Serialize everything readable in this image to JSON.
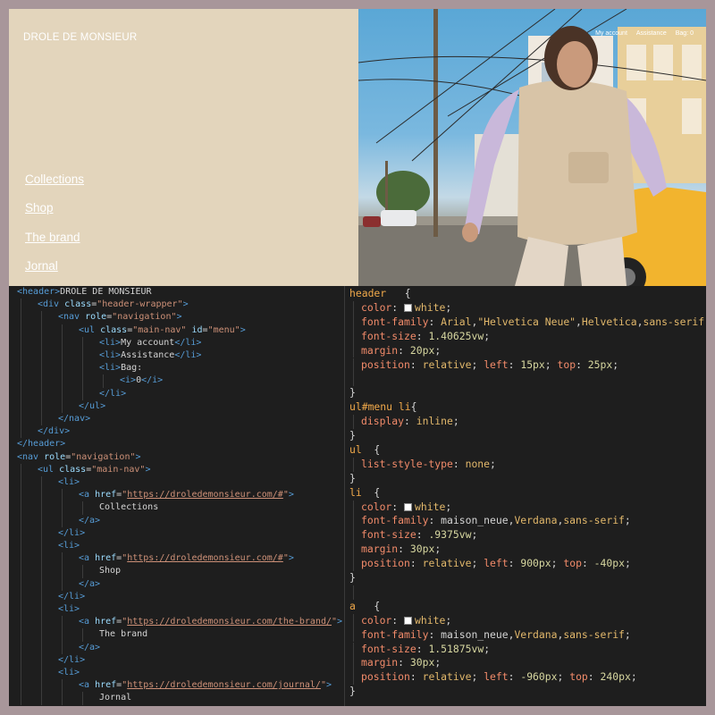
{
  "preview": {
    "brand": "DROLE DE MONSIEUR",
    "side_nav": [
      "Collections",
      "Shop",
      "The brand",
      "Jornal"
    ],
    "top_nav": [
      "My account",
      "Assistance",
      "Bag: 0"
    ]
  },
  "html_code": [
    {
      "indent": 0,
      "parts": [
        [
          "tag",
          "<header>"
        ],
        [
          "txt",
          "DROLE DE MONSIEUR"
        ]
      ]
    },
    {
      "indent": 1,
      "parts": [
        [
          "tag",
          "<div "
        ],
        [
          "attr",
          "class"
        ],
        [
          "txt",
          "="
        ],
        [
          "val",
          "\"header-wrapper\""
        ],
        [
          "tag",
          ">"
        ]
      ]
    },
    {
      "indent": 2,
      "parts": [
        [
          "tag",
          "<nav "
        ],
        [
          "attr",
          "role"
        ],
        [
          "txt",
          "="
        ],
        [
          "val",
          "\"navigation\""
        ],
        [
          "tag",
          ">"
        ]
      ]
    },
    {
      "indent": 3,
      "parts": [
        [
          "tag",
          "<ul "
        ],
        [
          "attr",
          "class"
        ],
        [
          "txt",
          "="
        ],
        [
          "val",
          "\"main-nav\""
        ],
        [
          "txt",
          " "
        ],
        [
          "attr",
          "id"
        ],
        [
          "txt",
          "="
        ],
        [
          "val",
          "\"menu\""
        ],
        [
          "tag",
          ">"
        ]
      ]
    },
    {
      "indent": 4,
      "parts": [
        [
          "tag",
          "<li>"
        ],
        [
          "txt",
          "My account"
        ],
        [
          "tag",
          "</li>"
        ]
      ]
    },
    {
      "indent": 4,
      "parts": [
        [
          "tag",
          "<li>"
        ],
        [
          "txt",
          "Assistance"
        ],
        [
          "tag",
          "</li>"
        ]
      ]
    },
    {
      "indent": 4,
      "parts": [
        [
          "tag",
          "<li>"
        ],
        [
          "txt",
          "Bag:"
        ]
      ]
    },
    {
      "indent": 5,
      "parts": [
        [
          "tag",
          "<i>"
        ],
        [
          "txt",
          "0"
        ],
        [
          "tag",
          "</i>"
        ]
      ]
    },
    {
      "indent": 4,
      "parts": [
        [
          "tag",
          "</li>"
        ]
      ]
    },
    {
      "indent": 3,
      "parts": [
        [
          "tag",
          "</ul>"
        ]
      ]
    },
    {
      "indent": 2,
      "parts": [
        [
          "tag",
          "</nav>"
        ]
      ]
    },
    {
      "indent": 1,
      "parts": [
        [
          "tag",
          "</div>"
        ]
      ]
    },
    {
      "indent": 0,
      "parts": [
        [
          "tag",
          "</header>"
        ]
      ]
    },
    {
      "indent": 0,
      "parts": [
        [
          "tag",
          "<nav "
        ],
        [
          "attr",
          "role"
        ],
        [
          "txt",
          "="
        ],
        [
          "val",
          "\"navigation\""
        ],
        [
          "tag",
          ">"
        ]
      ]
    },
    {
      "indent": 1,
      "parts": [
        [
          "tag",
          "<ul "
        ],
        [
          "attr",
          "class"
        ],
        [
          "txt",
          "="
        ],
        [
          "val",
          "\"main-nav\""
        ],
        [
          "tag",
          ">"
        ]
      ]
    },
    {
      "indent": 2,
      "parts": [
        [
          "tag",
          "<li>"
        ]
      ]
    },
    {
      "indent": 3,
      "parts": [
        [
          "tag",
          "<a "
        ],
        [
          "attr",
          "href"
        ],
        [
          "txt",
          "="
        ],
        [
          "val",
          "\""
        ],
        [
          "url",
          "https://droledemonsieur.com/#"
        ],
        [
          "val",
          "\""
        ],
        [
          "tag",
          ">"
        ]
      ]
    },
    {
      "indent": 4,
      "parts": [
        [
          "txt",
          "Collections"
        ]
      ]
    },
    {
      "indent": 3,
      "parts": [
        [
          "tag",
          "</a>"
        ]
      ]
    },
    {
      "indent": 2,
      "parts": [
        [
          "tag",
          "</li>"
        ]
      ]
    },
    {
      "indent": 2,
      "parts": [
        [
          "tag",
          "<li>"
        ]
      ]
    },
    {
      "indent": 3,
      "parts": [
        [
          "tag",
          "<a "
        ],
        [
          "attr",
          "href"
        ],
        [
          "txt",
          "="
        ],
        [
          "val",
          "\""
        ],
        [
          "url",
          "https://droledemonsieur.com/#"
        ],
        [
          "val",
          "\""
        ],
        [
          "tag",
          ">"
        ]
      ]
    },
    {
      "indent": 4,
      "parts": [
        [
          "txt",
          "Shop"
        ]
      ]
    },
    {
      "indent": 3,
      "parts": [
        [
          "tag",
          "</a>"
        ]
      ]
    },
    {
      "indent": 2,
      "parts": [
        [
          "tag",
          "</li>"
        ]
      ]
    },
    {
      "indent": 2,
      "parts": [
        [
          "tag",
          "<li>"
        ]
      ]
    },
    {
      "indent": 3,
      "parts": [
        [
          "tag",
          "<a "
        ],
        [
          "attr",
          "href"
        ],
        [
          "txt",
          "="
        ],
        [
          "val",
          "\""
        ],
        [
          "url",
          "https://droledemonsieur.com/the-brand/"
        ],
        [
          "val",
          "\""
        ],
        [
          "tag",
          ">"
        ]
      ]
    },
    {
      "indent": 4,
      "parts": [
        [
          "txt",
          "The brand"
        ]
      ]
    },
    {
      "indent": 3,
      "parts": [
        [
          "tag",
          "</a>"
        ]
      ]
    },
    {
      "indent": 2,
      "parts": [
        [
          "tag",
          "</li>"
        ]
      ]
    },
    {
      "indent": 2,
      "parts": [
        [
          "tag",
          "<li>"
        ]
      ]
    },
    {
      "indent": 3,
      "parts": [
        [
          "tag",
          "<a "
        ],
        [
          "attr",
          "href"
        ],
        [
          "txt",
          "="
        ],
        [
          "val",
          "\""
        ],
        [
          "url",
          "https://droledemonsieur.com/journal/"
        ],
        [
          "val",
          "\""
        ],
        [
          "tag",
          ">"
        ]
      ]
    },
    {
      "indent": 4,
      "parts": [
        [
          "txt",
          "Jornal"
        ]
      ]
    }
  ],
  "css_code": [
    {
      "indent": 0,
      "parts": [
        [
          "sel",
          "header"
        ],
        [
          "pun",
          "   {"
        ]
      ]
    },
    {
      "indent": 1,
      "parts": [
        [
          "prop",
          "color"
        ],
        [
          "pun",
          ": "
        ],
        [
          "swatch",
          ""
        ],
        [
          "val",
          "white"
        ],
        [
          "pun",
          ";"
        ]
      ]
    },
    {
      "indent": 1,
      "parts": [
        [
          "prop",
          "font-family"
        ],
        [
          "pun",
          ": "
        ],
        [
          "val",
          "Arial"
        ],
        [
          "pun",
          ","
        ],
        [
          "val",
          "\"Helvetica Neue\""
        ],
        [
          "pun",
          ","
        ],
        [
          "val",
          "Helvetica"
        ],
        [
          "pun",
          ","
        ],
        [
          "val",
          "sans-serif"
        ],
        [
          "pun",
          ";"
        ]
      ]
    },
    {
      "indent": 1,
      "parts": [
        [
          "prop",
          "font-size"
        ],
        [
          "pun",
          ": "
        ],
        [
          "num",
          "1.40625vw"
        ],
        [
          "pun",
          ";"
        ]
      ]
    },
    {
      "indent": 1,
      "parts": [
        [
          "prop",
          "margin"
        ],
        [
          "pun",
          ": "
        ],
        [
          "num",
          "20px"
        ],
        [
          "pun",
          ";"
        ]
      ]
    },
    {
      "indent": 1,
      "parts": [
        [
          "prop",
          "position"
        ],
        [
          "pun",
          ": "
        ],
        [
          "val",
          "relative"
        ],
        [
          "pun",
          "; "
        ],
        [
          "prop",
          "left"
        ],
        [
          "pun",
          ": "
        ],
        [
          "num",
          "15px"
        ],
        [
          "pun",
          "; "
        ],
        [
          "prop",
          "top"
        ],
        [
          "pun",
          ": "
        ],
        [
          "num",
          "25px"
        ],
        [
          "pun",
          ";"
        ]
      ]
    },
    {
      "indent": 1,
      "parts": []
    },
    {
      "indent": 0,
      "parts": [
        [
          "pun",
          "}"
        ]
      ]
    },
    {
      "indent": 0,
      "parts": [
        [
          "sel",
          "ul#menu li"
        ],
        [
          "pun",
          "{"
        ]
      ]
    },
    {
      "indent": 1,
      "parts": [
        [
          "prop",
          "display"
        ],
        [
          "pun",
          ": "
        ],
        [
          "val",
          "inline"
        ],
        [
          "pun",
          ";"
        ]
      ]
    },
    {
      "indent": 0,
      "parts": [
        [
          "pun",
          "}"
        ]
      ]
    },
    {
      "indent": 0,
      "parts": [
        [
          "sel",
          "ul"
        ],
        [
          "pun",
          "  {"
        ]
      ]
    },
    {
      "indent": 1,
      "parts": [
        [
          "prop",
          "list-style-type"
        ],
        [
          "pun",
          ": "
        ],
        [
          "val",
          "none"
        ],
        [
          "pun",
          ";"
        ]
      ]
    },
    {
      "indent": 0,
      "parts": [
        [
          "pun",
          "}"
        ]
      ]
    },
    {
      "indent": 0,
      "parts": [
        [
          "sel",
          "li"
        ],
        [
          "pun",
          "  {"
        ]
      ]
    },
    {
      "indent": 1,
      "parts": [
        [
          "prop",
          "color"
        ],
        [
          "pun",
          ": "
        ],
        [
          "swatch",
          ""
        ],
        [
          "val",
          "white"
        ],
        [
          "pun",
          ";"
        ]
      ]
    },
    {
      "indent": 1,
      "parts": [
        [
          "prop",
          "font-family"
        ],
        [
          "pun",
          ": "
        ],
        [
          "txt",
          "maison_neue"
        ],
        [
          "pun",
          ","
        ],
        [
          "val",
          "Verdana"
        ],
        [
          "pun",
          ","
        ],
        [
          "val",
          "sans-serif"
        ],
        [
          "pun",
          ";"
        ]
      ]
    },
    {
      "indent": 1,
      "parts": [
        [
          "prop",
          "font-size"
        ],
        [
          "pun",
          ": "
        ],
        [
          "num",
          ".9375vw"
        ],
        [
          "pun",
          ";"
        ]
      ]
    },
    {
      "indent": 1,
      "parts": [
        [
          "prop",
          "margin"
        ],
        [
          "pun",
          ": "
        ],
        [
          "num",
          "30px"
        ],
        [
          "pun",
          ";"
        ]
      ]
    },
    {
      "indent": 1,
      "parts": [
        [
          "prop",
          "position"
        ],
        [
          "pun",
          ": "
        ],
        [
          "val",
          "relative"
        ],
        [
          "pun",
          "; "
        ],
        [
          "prop",
          "left"
        ],
        [
          "pun",
          ": "
        ],
        [
          "num",
          "900px"
        ],
        [
          "pun",
          "; "
        ],
        [
          "prop",
          "top"
        ],
        [
          "pun",
          ": "
        ],
        [
          "num",
          "-40px"
        ],
        [
          "pun",
          ";"
        ]
      ]
    },
    {
      "indent": 0,
      "parts": [
        [
          "pun",
          "}"
        ]
      ]
    },
    {
      "indent": 1,
      "parts": []
    },
    {
      "indent": 0,
      "parts": [
        [
          "sel",
          "a"
        ],
        [
          "pun",
          "   {"
        ]
      ]
    },
    {
      "indent": 1,
      "parts": [
        [
          "prop",
          "color"
        ],
        [
          "pun",
          ": "
        ],
        [
          "swatch",
          ""
        ],
        [
          "val",
          "white"
        ],
        [
          "pun",
          ";"
        ]
      ]
    },
    {
      "indent": 1,
      "parts": [
        [
          "prop",
          "font-family"
        ],
        [
          "pun",
          ": "
        ],
        [
          "txt",
          "maison_neue"
        ],
        [
          "pun",
          ","
        ],
        [
          "val",
          "Verdana"
        ],
        [
          "pun",
          ","
        ],
        [
          "val",
          "sans-serif"
        ],
        [
          "pun",
          ";"
        ]
      ]
    },
    {
      "indent": 1,
      "parts": [
        [
          "prop",
          "font-size"
        ],
        [
          "pun",
          ": "
        ],
        [
          "num",
          "1.51875vw"
        ],
        [
          "pun",
          ";"
        ]
      ]
    },
    {
      "indent": 1,
      "parts": [
        [
          "prop",
          "margin"
        ],
        [
          "pun",
          ": "
        ],
        [
          "num",
          "30px"
        ],
        [
          "pun",
          ";"
        ]
      ]
    },
    {
      "indent": 1,
      "parts": [
        [
          "prop",
          "position"
        ],
        [
          "pun",
          ": "
        ],
        [
          "val",
          "relative"
        ],
        [
          "pun",
          "; "
        ],
        [
          "prop",
          "left"
        ],
        [
          "pun",
          ": "
        ],
        [
          "num",
          "-960px"
        ],
        [
          "pun",
          "; "
        ],
        [
          "prop",
          "top"
        ],
        [
          "pun",
          ": "
        ],
        [
          "num",
          "240px"
        ],
        [
          "pun",
          ";"
        ]
      ]
    },
    {
      "indent": 0,
      "parts": [
        [
          "pun",
          "}"
        ]
      ]
    }
  ]
}
